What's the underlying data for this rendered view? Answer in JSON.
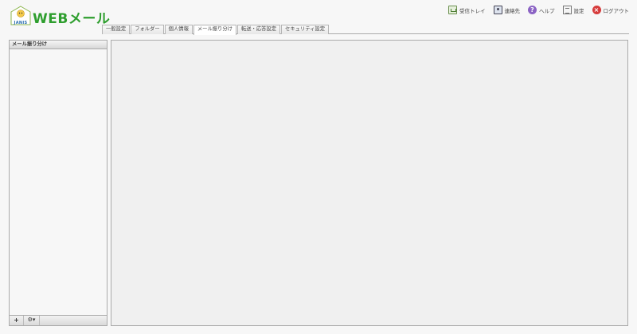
{
  "header": {
    "logo_brand": "JANIS",
    "app_title": "WEBメール"
  },
  "toolbar": {
    "links": [
      {
        "label": "受信トレイ",
        "icon": "inbox-icon"
      },
      {
        "label": "連絡先",
        "icon": "contacts-icon"
      },
      {
        "label": "ヘルプ",
        "icon": "help-icon"
      },
      {
        "label": "設定",
        "icon": "settings-icon"
      },
      {
        "label": "ログアウト",
        "icon": "logout-icon"
      }
    ]
  },
  "tabs": [
    {
      "label": "一般設定",
      "active": false
    },
    {
      "label": "フォルダー",
      "active": false
    },
    {
      "label": "個人情報",
      "active": false
    },
    {
      "label": "メール振り分け",
      "active": true
    },
    {
      "label": "転送・応答設定",
      "active": false
    },
    {
      "label": "セキュリティ設定",
      "active": false
    }
  ],
  "left_panel": {
    "title": "メール振り分け",
    "add_label": "+",
    "gear_label": "⚙▾"
  },
  "colors": {
    "brand_green": "#2e9e2e",
    "help_purple": "#8b63c4",
    "logout_red": "#d63b3b"
  }
}
